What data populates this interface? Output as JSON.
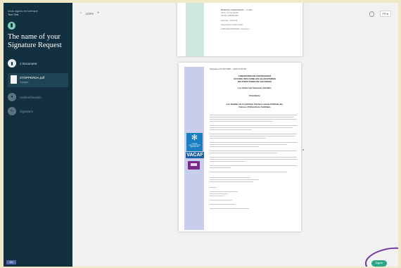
{
  "sidebar": {
    "greeting_line1": "Vous signez en tant que",
    "greeting_line2": "Tom Ted",
    "request_title": "The name of your Signature Request",
    "documents_label": "1 Document",
    "document_name": "STOPPERDA.pdf",
    "document_pages": "3 pages",
    "authentication_label": "Authentification",
    "signature_label": "Signature",
    "language_badge": "EN"
  },
  "toolbar": {
    "zoom_out": "−",
    "zoom_level": "100%",
    "zoom_in": "+",
    "language_select": "FR ▾"
  },
  "document": {
    "page1_lines": [
      "BENEFICE LA FERIA DEDUIT — C rodier",
      "Intitulé : 10 rue Moufflet",
      "NB DE L ORPHELINES",
      "Domiciles : SUR E FE",
      "Responsable de Paris Fédéré",
      "OUBLIANCE BASSINES - Frauzines 1"
    ],
    "page2_header": "Numération CAF 4897 9980 — Minormin PR 790",
    "page2_title": [
      "CONVENTION DE PARTENARIAT",
      "ACCUEIL DES FAMILLES ALLOCATAIRES",
      "EN STRUCTURES DE VACANCES"
    ],
    "page2_subtitle": "Les Aides aux Vacances Familles",
    "page2_preamble": "Préambule",
    "page2_section": [
      "Les finalités de la politique d'action sociale familiale des",
      "Caisses d'Allocations familiales"
    ],
    "logo_caf_caption": "CAISSE D'ALLOCATIONS FAMILIALES",
    "logo_vacaf": "VACAF"
  },
  "actions": {
    "sign_label": "Signer"
  }
}
